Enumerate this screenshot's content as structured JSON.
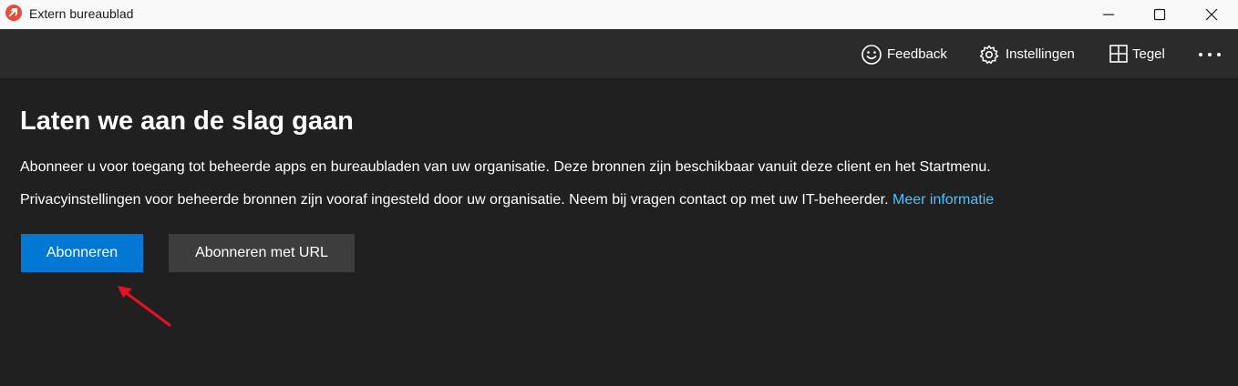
{
  "window": {
    "title": "Extern bureaublad",
    "icon": "remote-desktop-icon",
    "controls": [
      "minimize-icon",
      "maximize-icon",
      "close-icon"
    ]
  },
  "toolbar": {
    "feedback_label": "Feedback",
    "settings_label": "Instellingen",
    "tile_label": "Tegel",
    "more_icon": "more-icon"
  },
  "main": {
    "heading": "Laten we aan de slag gaan",
    "paragraph1": "Abonneer u voor toegang tot beheerde apps en bureaubladen van uw organisatie. Deze bronnen zijn beschikbaar vanuit deze client en het Startmenu.",
    "paragraph2_text": "Privacyinstellingen voor beheerde bronnen zijn vooraf ingesteld door uw organisatie. Neem bij vragen contact op met uw IT-beheerder.",
    "paragraph2_link": "Meer informatie",
    "subscribe_button": "Abonneren",
    "subscribe_url_button": "Abonneren met URL"
  },
  "colors": {
    "primary": "#0078d4",
    "link": "#4cc2ff",
    "annotation_arrow": "#e81123",
    "background": "#202020",
    "toolbar": "#2b2b2b"
  }
}
